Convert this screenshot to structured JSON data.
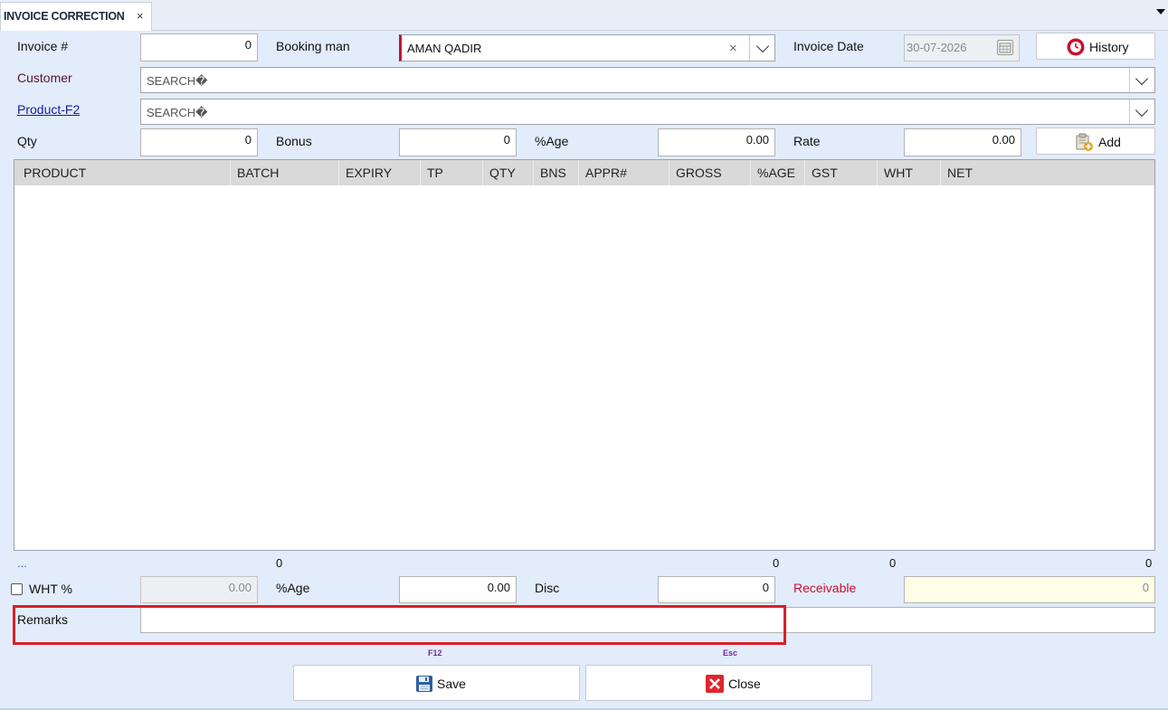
{
  "tab": {
    "title": "INVOICE CORRECTION",
    "close": "×"
  },
  "labels": {
    "invoice_no": "Invoice #",
    "booking_man": "Booking man",
    "invoice_date": "Invoice Date",
    "customer": "Customer",
    "product": "Product-F2",
    "qty": "Qty",
    "bonus": "Bonus",
    "age": "%Age",
    "rate": "Rate",
    "wht": "WHT %",
    "age2": "%Age",
    "disc": "Disc",
    "receivable": "Receivable",
    "remarks": "Remarks"
  },
  "fields": {
    "invoice_no": "0",
    "booking_man": "AMAN QADIR",
    "booking_clear": "×",
    "invoice_date": "30-07-2026",
    "customer_placeholder": "SEARCH�",
    "product_placeholder": "SEARCH�",
    "qty": "0",
    "bonus": "0",
    "age": "0.00",
    "rate": "0.00",
    "wht_value": "0.00",
    "age2": "0.00",
    "disc": "0",
    "receivable": "0",
    "remarks": ""
  },
  "buttons": {
    "history": "History",
    "add": "Add",
    "save": "Save",
    "close": "Close",
    "save_hint": "F12",
    "close_hint": "Esc"
  },
  "grid": {
    "columns": [
      "PRODUCT",
      "BATCH",
      "EXPIRY",
      "TP",
      "QTY",
      "BNS",
      "APPR#",
      "GROSS",
      "%AGE",
      "GST",
      "WHT",
      "NET"
    ],
    "rows": []
  },
  "footer": {
    "ellipsis": "...",
    "total_qty": "0",
    "total_gross": "0",
    "total_wht": "0",
    "total_net": "0"
  },
  "colors": {
    "accent_red": "#c8102e",
    "form_background": "#e2ecfa",
    "highlight_box": "#d8202a"
  }
}
